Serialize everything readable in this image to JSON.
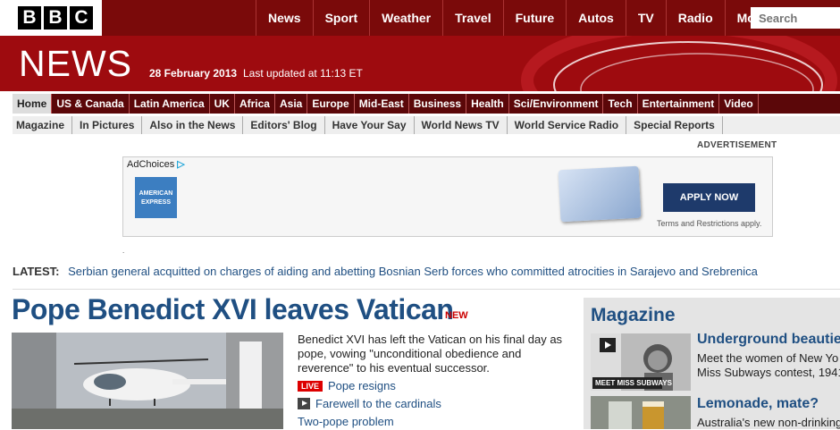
{
  "brand": {
    "logo_letters": [
      "B",
      "B",
      "C"
    ]
  },
  "top_nav": [
    "News",
    "Sport",
    "Weather",
    "Travel",
    "Future",
    "Autos",
    "TV",
    "Radio",
    "More..."
  ],
  "search": {
    "placeholder": "Search"
  },
  "masthead": {
    "title": "NEWS",
    "date": "28 February 2013",
    "updated": "Last updated at 11:13 ET"
  },
  "primary_nav": [
    "Home",
    "US & Canada",
    "Latin America",
    "UK",
    "Africa",
    "Asia",
    "Europe",
    "Mid-East",
    "Business",
    "Health",
    "Sci/Environment",
    "Tech",
    "Entertainment",
    "Video"
  ],
  "secondary_nav": [
    "Magazine",
    "In Pictures",
    "Also in the News",
    "Editors' Blog",
    "Have Your Say",
    "World News TV",
    "World Service Radio",
    "Special Reports"
  ],
  "advert": {
    "label": "ADVERTISEMENT",
    "adchoices": "AdChoices",
    "brand": "AMERICAN EXPRESS",
    "cta": "APPLY NOW",
    "terms": "Terms and Restrictions apply."
  },
  "latest": {
    "label": "LATEST:",
    "text": "Serbian general acquitted on charges of aiding and abetting Bosnian Serb forces who committed atrocities in Sarajevo and Srebrenica"
  },
  "main_story": {
    "headline": "Pope Benedict XVI leaves Vatican",
    "new_tag": "NEW",
    "summary": "Benedict XVI has left the Vatican on his final day as pope, vowing \"unconditional obedience and reverence\" to his eventual successor.",
    "related": [
      {
        "badge": "LIVE",
        "text": "Pope resigns"
      },
      {
        "badge": "video",
        "text": "Farewell to the cardinals"
      },
      {
        "badge": "",
        "text": "Two-pope problem"
      }
    ]
  },
  "magazine": {
    "title": "Magazine",
    "stories": [
      {
        "headline": "Underground beautie",
        "text_lines": [
          "Meet the women of New Yo",
          "Miss Subways contest, 1941"
        ],
        "image_caption": "MEET MISS SUBWAYS"
      },
      {
        "headline": "Lemonade, mate?",
        "text_lines": [
          "Australia's new non-drinking"
        ]
      }
    ]
  },
  "colors": {
    "masthead_red": "#9e0b0f",
    "link_blue": "#1f4f82",
    "nav_dark": "#5b0709",
    "live_red": "#d00"
  }
}
